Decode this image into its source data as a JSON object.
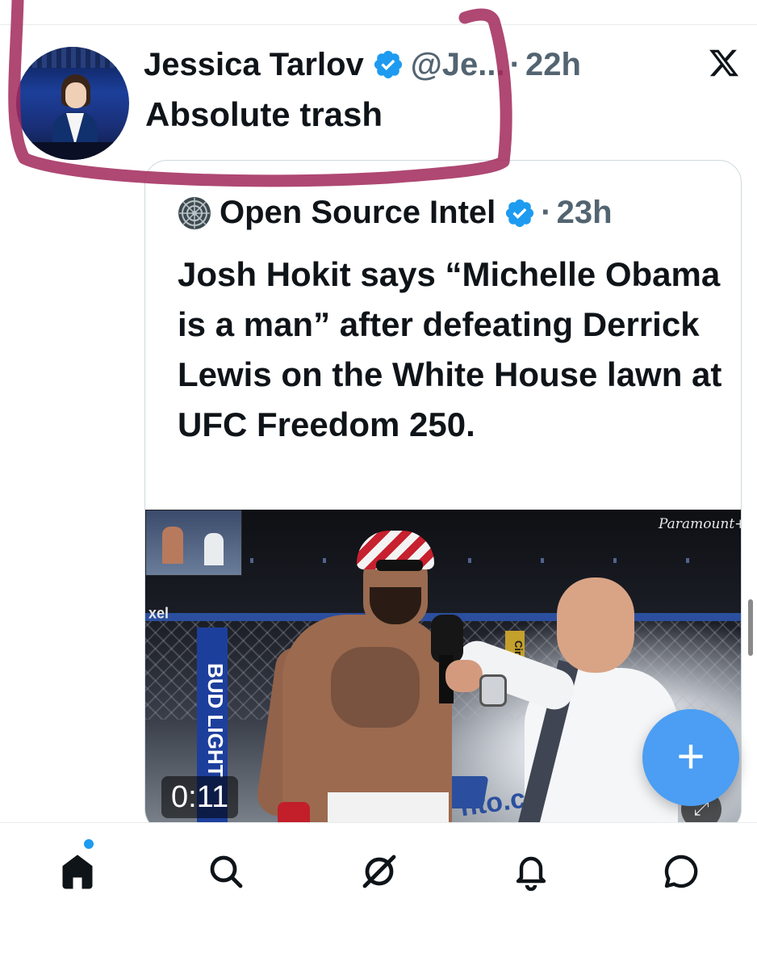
{
  "tweet": {
    "author_name": "Jessica Tarlov",
    "handle": "@Je...",
    "separator": "·",
    "time": "22h",
    "text": "Absolute trash",
    "verified_color": "#1d9bf0"
  },
  "quoted_tweet": {
    "author_name": "Open Source Intel",
    "separator": "·",
    "time": "23h",
    "text": "Josh Hokit says “Michelle Obama is a man” after defeating Derrick Lewis on the White House lawn at UFC Freedom 250.",
    "video": {
      "duration": "0:11",
      "watermark": "Paramount+",
      "banner_text": "BUD LIGHT",
      "rail_text": "xel",
      "cup_text": "Cirrus",
      "floor_text": "nto.c"
    }
  },
  "icons": {
    "close": "x-logo-icon",
    "compose": "plus-icon",
    "verified": "verified-badge-icon"
  },
  "fab": {
    "label": "+"
  },
  "tabbar": {
    "items": [
      {
        "name": "home",
        "icon": "home-icon",
        "active": true,
        "has_notification_dot": true
      },
      {
        "name": "search",
        "icon": "search-icon",
        "active": false
      },
      {
        "name": "grok",
        "icon": "grok-icon",
        "active": false
      },
      {
        "name": "notifications",
        "icon": "bell-icon",
        "active": false
      },
      {
        "name": "messages",
        "icon": "chat-icon",
        "active": false
      }
    ]
  },
  "colors": {
    "brand_blue": "#1d9bf0",
    "fab_blue": "#4b9ef3",
    "highlight_stroke": "#a1285a",
    "text_primary": "#0f1419",
    "text_secondary": "#536471"
  }
}
